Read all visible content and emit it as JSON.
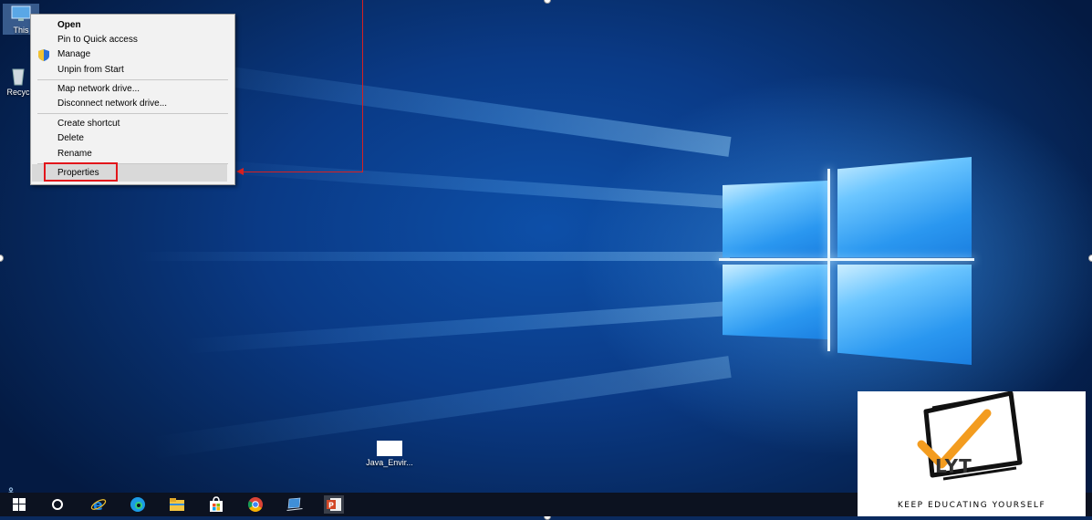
{
  "desktop": {
    "icons": [
      {
        "label": "This"
      },
      {
        "label": "Recyc"
      },
      {
        "label": "Java_Envir..."
      }
    ]
  },
  "context_menu": {
    "items": [
      {
        "label": "Open"
      },
      {
        "label": "Pin to Quick access"
      },
      {
        "label": "Manage"
      },
      {
        "label": "Unpin from Start"
      },
      {
        "label": "Map network drive..."
      },
      {
        "label": "Disconnect network drive..."
      },
      {
        "label": "Create shortcut"
      },
      {
        "label": "Delete"
      },
      {
        "label": "Rename"
      },
      {
        "label": "Properties"
      }
    ]
  },
  "taskbar": {
    "icons": [
      "start-icon",
      "cortana-icon",
      "internet-explorer-icon",
      "edge-icon",
      "file-explorer-icon",
      "store-icon",
      "chrome-icon",
      "laptop-icon",
      "powerpoint-icon"
    ]
  },
  "logo": {
    "text": "LYT",
    "tagline": "KEEP EDUCATING YOURSELF"
  },
  "colors": {
    "annotation_red": "#e2161b",
    "logo_orange": "#f39c1f"
  }
}
